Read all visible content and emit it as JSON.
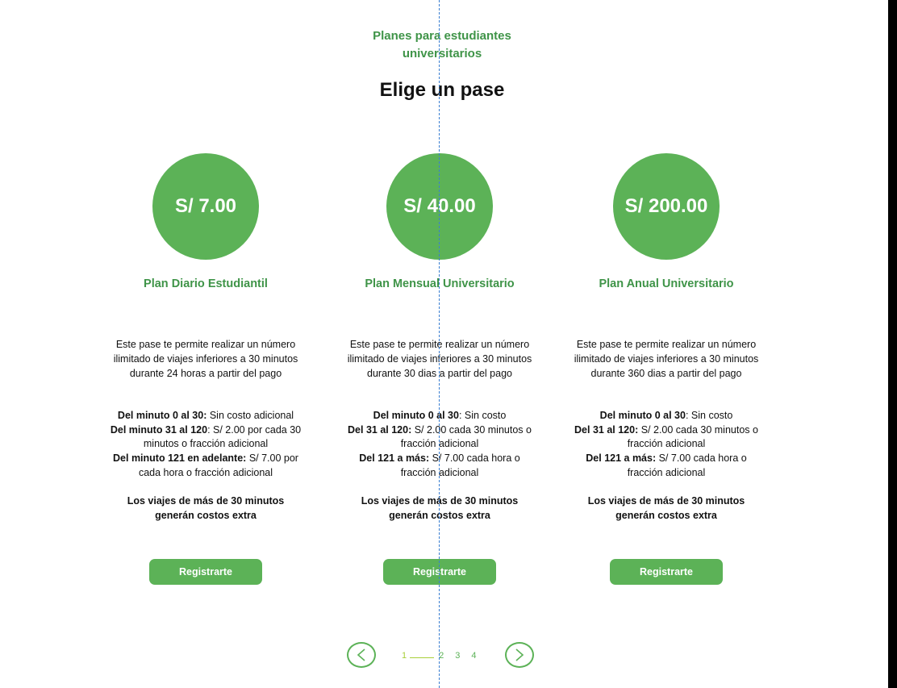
{
  "header": {
    "eyebrow": "Planes para estudiantes universitarios",
    "title": "Elige un pase"
  },
  "plans": [
    {
      "price": "S/ 7.00",
      "title": "Plan Diario Estudiantil",
      "description": "Este pase te permite realizar un número ilimitado de viajes inferiores a 30 minutos durante 24 horas a partir del pago",
      "rules": [
        {
          "label": "Del minuto 0 al 30:",
          "text": " Sin costo adicional"
        },
        {
          "label": "Del minuto 31 al 120",
          "text": ": S/ 2.00 por cada 30 minutos o fracción adicional"
        },
        {
          "label": "Del minuto 121 en adelante:",
          "text": " S/ 7.00 por cada hora o fracción adicional"
        }
      ],
      "note": "Los viajes de más de 30 minutos generán costos extra",
      "button": "Registrarte"
    },
    {
      "price": "S/ 40.00",
      "title": "Plan Mensual Universitario",
      "description": "Este pase te permite realizar un número ilimitado de viajes inferiores a 30 minutos durante 30 dias a partir del pago",
      "rules": [
        {
          "label": "Del minuto 0 al 30",
          "text": ": Sin costo"
        },
        {
          "label": "Del 31 al 120:",
          "text": " S/ 2.00 cada 30 minutos o fracción adicional"
        },
        {
          "label": "Del 121 a más:",
          "text": " S/ 7.00 cada hora o fracción adicional"
        }
      ],
      "note": "Los viajes de más de 30 minutos generán costos extra",
      "button": "Registrarte"
    },
    {
      "price": "S/ 200.00",
      "title": "Plan Anual Universitario",
      "description": "Este pase te permite realizar un número ilimitado de viajes inferiores a 30 minutos durante 360 dias a partir del pago",
      "rules": [
        {
          "label": "Del minuto 0 al 30",
          "text": ": Sin costo"
        },
        {
          "label": "Del 31 al 120:",
          "text": " S/ 2.00 cada 30 minutos o fracción adicional"
        },
        {
          "label": "Del 121 a más:",
          "text": " S/ 7.00 cada hora o fracción adicional"
        }
      ],
      "note": "Los viajes de más de 30 minutos generán costos extra",
      "button": "Registrarte"
    }
  ],
  "pagination": {
    "pages": [
      "1",
      "2",
      "3",
      "4"
    ],
    "active": "1",
    "prev_icon": "chevron-left-icon",
    "next_icon": "chevron-right-icon"
  },
  "colors": {
    "accent": "#5cb257",
    "heading_green": "#3f9448",
    "active_page": "#a8cf39",
    "guide_line": "#3b7fd1"
  }
}
